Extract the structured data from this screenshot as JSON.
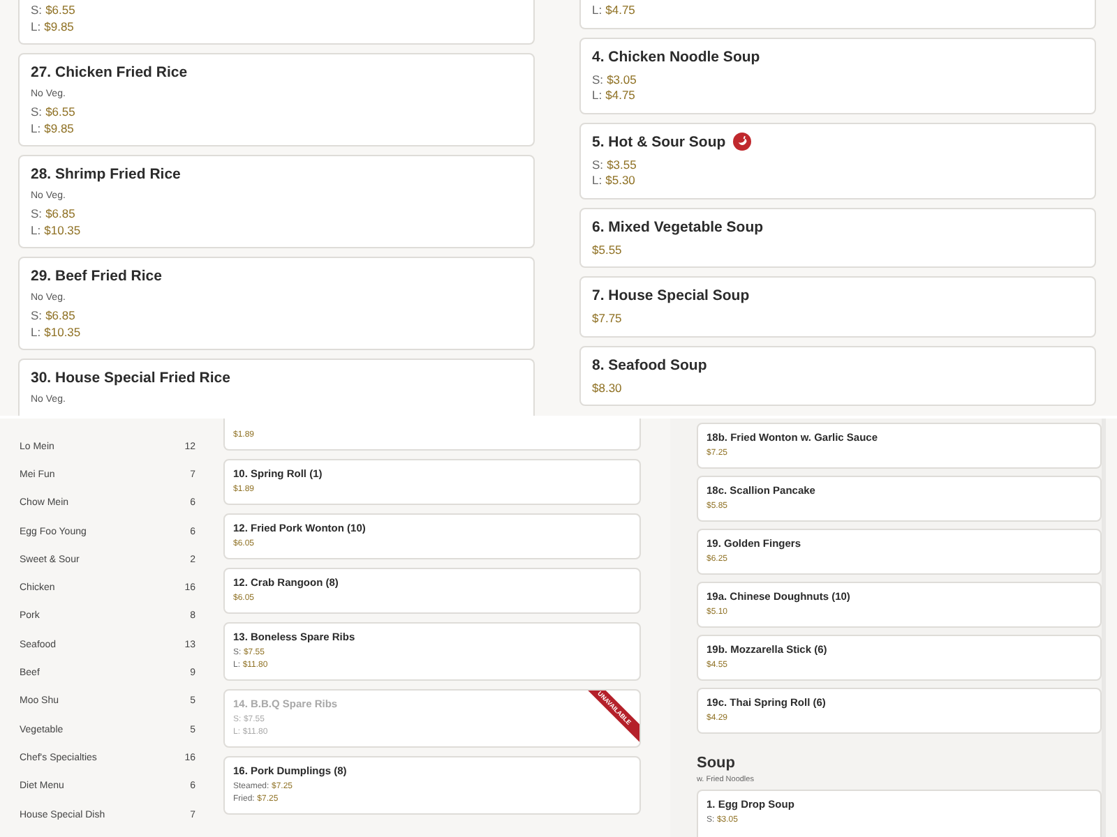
{
  "top_left_cards": [
    {
      "kind": "cut_top",
      "prices": [
        {
          "label": "S:",
          "amount": "$6.55"
        },
        {
          "label": "L:",
          "amount": "$9.85"
        }
      ]
    },
    {
      "kind": "full",
      "title": "27. Chicken Fried Rice",
      "note": "No Veg.",
      "prices": [
        {
          "label": "S:",
          "amount": "$6.55"
        },
        {
          "label": "L:",
          "amount": "$9.85"
        }
      ]
    },
    {
      "kind": "full",
      "title": "28. Shrimp Fried Rice",
      "note": "No Veg.",
      "prices": [
        {
          "label": "S:",
          "amount": "$6.85"
        },
        {
          "label": "L:",
          "amount": "$10.35"
        }
      ]
    },
    {
      "kind": "full",
      "title": "29. Beef Fried Rice",
      "note": "No Veg.",
      "prices": [
        {
          "label": "S:",
          "amount": "$6.85"
        },
        {
          "label": "L:",
          "amount": "$10.35"
        }
      ]
    },
    {
      "kind": "cut_bottom",
      "title": "30. House Special Fried Rice",
      "note": "No Veg."
    }
  ],
  "top_right_cards": [
    {
      "kind": "cut_top",
      "prices": [
        {
          "label": "L:",
          "amount": "$4.75"
        }
      ]
    },
    {
      "kind": "full",
      "spicy": false,
      "title": "4. Chicken Noodle Soup",
      "prices": [
        {
          "label": "S:",
          "amount": "$3.05"
        },
        {
          "label": "L:",
          "amount": "$4.75"
        }
      ]
    },
    {
      "kind": "full",
      "spicy": true,
      "title": "5. Hot & Sour Soup",
      "prices": [
        {
          "label": "S:",
          "amount": "$3.55"
        },
        {
          "label": "L:",
          "amount": "$5.30"
        }
      ]
    },
    {
      "kind": "full",
      "spicy": false,
      "title": "6. Mixed Vegetable Soup",
      "prices": [
        {
          "amount": "$5.55"
        }
      ]
    },
    {
      "kind": "full",
      "spicy": false,
      "title": "7. House Special Soup",
      "prices": [
        {
          "amount": "$7.75"
        }
      ]
    },
    {
      "kind": "full",
      "spicy": false,
      "title": "8. Seafood Soup",
      "prices": [
        {
          "amount": "$8.30"
        }
      ]
    }
  ],
  "sidebar": {
    "categories": [
      {
        "name": "Lo Mein",
        "count": "12"
      },
      {
        "name": "Mei Fun",
        "count": "7"
      },
      {
        "name": "Chow Mein",
        "count": "6"
      },
      {
        "name": "Egg Foo Young",
        "count": "6"
      },
      {
        "name": "Sweet & Sour",
        "count": "2"
      },
      {
        "name": "Chicken",
        "count": "16"
      },
      {
        "name": "Pork",
        "count": "8"
      },
      {
        "name": "Seafood",
        "count": "13"
      },
      {
        "name": "Beef",
        "count": "9"
      },
      {
        "name": "Moo Shu",
        "count": "5"
      },
      {
        "name": "Vegetable",
        "count": "5"
      },
      {
        "name": "Chef's Specialties",
        "count": "16"
      },
      {
        "name": "Diet Menu",
        "count": "6"
      },
      {
        "name": "House Special Dish",
        "count": "7"
      }
    ]
  },
  "middle_cards": [
    {
      "kind": "cut_top",
      "unavailable": false,
      "prices": [
        {
          "amount": "$1.89"
        }
      ]
    },
    {
      "kind": "full",
      "unavailable": false,
      "title": "10. Spring Roll (1)",
      "prices": [
        {
          "amount": "$1.89"
        }
      ]
    },
    {
      "kind": "full",
      "unavailable": false,
      "title": "12. Fried Pork Wonton (10)",
      "prices": [
        {
          "amount": "$6.05"
        }
      ]
    },
    {
      "kind": "full",
      "unavailable": false,
      "title": "12. Crab Rangoon (8)",
      "prices": [
        {
          "amount": "$6.05"
        }
      ]
    },
    {
      "kind": "full",
      "unavailable": false,
      "title": "13. Boneless Spare Ribs",
      "prices": [
        {
          "label": "S:",
          "amount": "$7.55"
        },
        {
          "label": "L:",
          "amount": "$11.80"
        }
      ]
    },
    {
      "kind": "full",
      "unavailable": true,
      "ribbon": "UNAVAILABLE",
      "title": "14. B.B.Q Spare Ribs",
      "prices": [
        {
          "label": "S:",
          "amount": "$7.55"
        },
        {
          "label": "L:",
          "amount": "$11.80"
        }
      ]
    },
    {
      "kind": "full",
      "unavailable": false,
      "title": "16. Pork Dumplings (8)",
      "prices": [
        {
          "label": "Steamed:",
          "amount": "$7.25"
        },
        {
          "label": "Fried:",
          "amount": "$7.25"
        }
      ]
    }
  ],
  "right_cards": [
    {
      "title": "18b. Fried Wonton w. Garlic Sauce",
      "prices": [
        {
          "amount": "$7.25"
        }
      ]
    },
    {
      "title": "18c. Scallion Pancake",
      "prices": [
        {
          "amount": "$5.85"
        }
      ]
    },
    {
      "title": "19. Golden Fingers",
      "prices": [
        {
          "amount": "$6.25"
        }
      ]
    },
    {
      "title": "19a. Chinese Doughnuts (10)",
      "prices": [
        {
          "amount": "$5.10"
        }
      ]
    },
    {
      "title": "19b. Mozzarella Stick (6)",
      "prices": [
        {
          "amount": "$4.55"
        }
      ]
    },
    {
      "title": "19c. Thai Spring Roll (6)",
      "prices": [
        {
          "amount": "$4.29"
        }
      ]
    }
  ],
  "soup_section": {
    "heading": "Soup",
    "subheading": "w. Fried Noodles",
    "cards": [
      {
        "kind": "cut_bottom",
        "title": "1. Egg Drop Soup",
        "prices": [
          {
            "label": "S:",
            "amount": "$3.05"
          }
        ]
      }
    ]
  }
}
